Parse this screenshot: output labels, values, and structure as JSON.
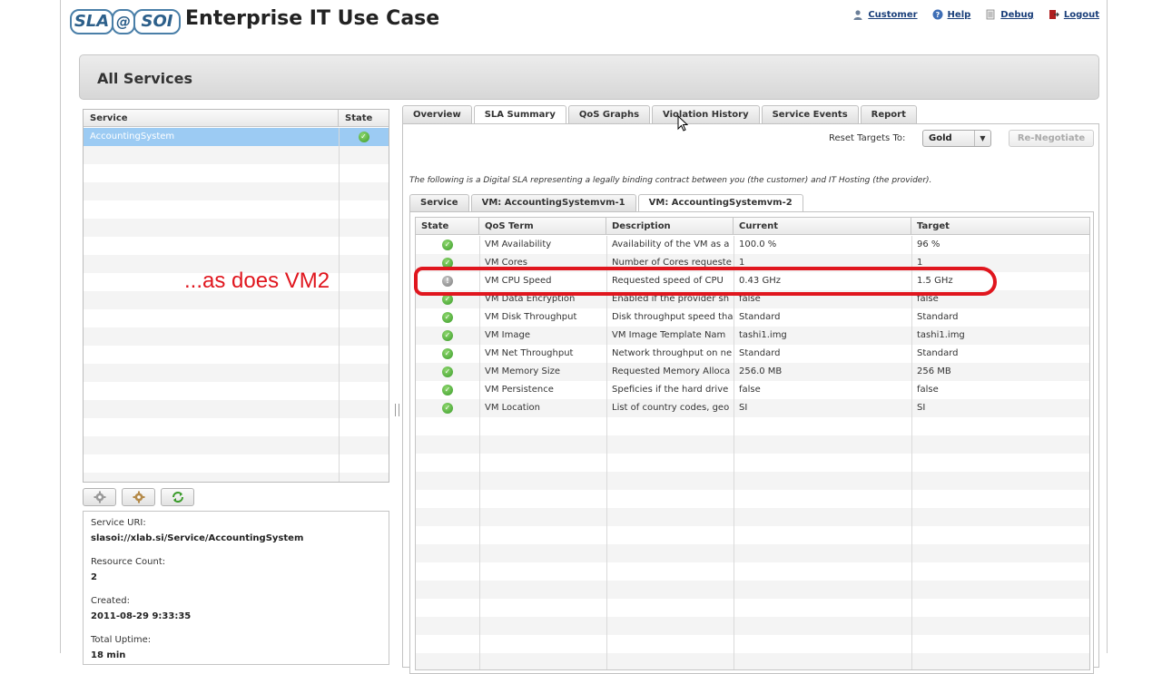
{
  "header": {
    "logo": {
      "sla": "SLA",
      "at": "@",
      "soi": "SOI"
    },
    "title": "Enterprise IT Use Case",
    "links": [
      {
        "label": "Customer",
        "icon": "user-icon"
      },
      {
        "label": "Help",
        "icon": "help-icon"
      },
      {
        "label": "Debug",
        "icon": "debug-icon"
      },
      {
        "label": "Logout",
        "icon": "logout-icon"
      }
    ]
  },
  "page": {
    "title": "All Services"
  },
  "services": {
    "columns": [
      "Service",
      "State"
    ],
    "rows": [
      {
        "name": "AccountingSystem",
        "state": "ok"
      }
    ]
  },
  "toolbar": {
    "buttons": [
      "settings-icon",
      "settings-gear-icon",
      "refresh-icon"
    ]
  },
  "info": {
    "uri_label": "Service URI:",
    "uri_value": "slasoi://xlab.si/Service/AccountingSystem",
    "resource_label": "Resource Count:",
    "resource_value": "2",
    "created_label": "Created:",
    "created_value": "2011-08-29 9:33:35",
    "uptime_label": "Total Uptime:",
    "uptime_value": "18 min"
  },
  "tabs": {
    "main": [
      "Overview",
      "SLA Summary",
      "QoS Graphs",
      "Violation History",
      "Service Events",
      "Report"
    ],
    "active": "SLA Summary"
  },
  "controls": {
    "reset_label": "Reset Targets To:",
    "reset_value": "Gold",
    "renegotiate_label": "Re-Negotiate"
  },
  "sla_description": "The following is a Digital SLA representing a legally binding contract between you (the customer) and IT Hosting (the provider).",
  "subtabs": {
    "items": [
      "Service",
      "VM: AccountingSystemvm-1",
      "VM: AccountingSystemvm-2"
    ],
    "active": "VM: AccountingSystemvm-2"
  },
  "qos": {
    "columns": [
      "State",
      "QoS Term",
      "Description",
      "Current",
      "Target"
    ],
    "rows": [
      {
        "state": "ok",
        "term": "VM Availability",
        "desc": "Availability of the VM as a",
        "current": "100.0 %",
        "target": "96 %"
      },
      {
        "state": "ok",
        "term": "VM Cores",
        "desc": "Number of Cores requeste",
        "current": "1",
        "target": "1"
      },
      {
        "state": "warn",
        "term": "VM CPU Speed",
        "desc": "Requested speed of CPU",
        "current": "0.43 GHz",
        "target": "1.5 GHz"
      },
      {
        "state": "ok",
        "term": "VM Data Encryption",
        "desc": "Enabled if the provider sh",
        "current": "false",
        "target": "false"
      },
      {
        "state": "ok",
        "term": "VM Disk Throughput",
        "desc": "Disk throughput speed tha",
        "current": "Standard",
        "target": "Standard"
      },
      {
        "state": "ok",
        "term": "VM Image",
        "desc": "VM Image Template Nam",
        "current": "tashi1.img",
        "target": "tashi1.img"
      },
      {
        "state": "ok",
        "term": "VM Net Throughput",
        "desc": "Network throughput on ne",
        "current": "Standard",
        "target": "Standard"
      },
      {
        "state": "ok",
        "term": "VM Memory Size",
        "desc": "Requested Memory Alloca",
        "current": "256.0 MB",
        "target": "256 MB"
      },
      {
        "state": "ok",
        "term": "VM Persistence",
        "desc": "Speficies if the hard drive",
        "current": "false",
        "target": "false"
      },
      {
        "state": "ok",
        "term": "VM Location",
        "desc": "List of country codes, geo",
        "current": "SI",
        "target": "SI"
      }
    ]
  },
  "annotation": {
    "text": "...as does VM2",
    "color": "#e0161e"
  },
  "colors": {
    "accent": "#e0161e",
    "selection": "#9ccbf3",
    "ok": "#3a9b2a",
    "link": "#1a3f7a"
  }
}
